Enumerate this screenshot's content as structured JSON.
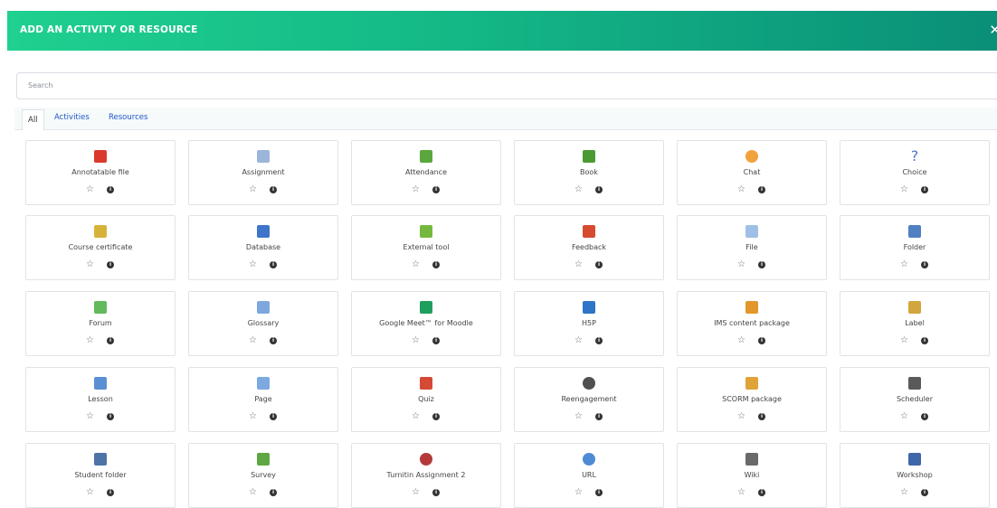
{
  "modal": {
    "title": "ADD AN ACTIVITY OR RESOURCE",
    "close_icon": "close-icon"
  },
  "search": {
    "value": "",
    "placeholder": "Search"
  },
  "tabs": [
    {
      "label": "All",
      "active": true
    },
    {
      "label": "Activities",
      "active": false
    },
    {
      "label": "Resources",
      "active": false
    }
  ],
  "items": [
    {
      "label": "Annotatable file",
      "icon": "annotatable-file-icon",
      "color": "#d93a2b"
    },
    {
      "label": "Assignment",
      "icon": "assignment-icon",
      "color": "#9bb6d9"
    },
    {
      "label": "Attendance",
      "icon": "attendance-icon",
      "color": "#5aa83d"
    },
    {
      "label": "Book",
      "icon": "book-icon",
      "color": "#4a9a34"
    },
    {
      "label": "Chat",
      "icon": "chat-icon",
      "color": "#f2a23c"
    },
    {
      "label": "Choice",
      "icon": "choice-icon",
      "color": "#4d79c7"
    },
    {
      "label": "Course certificate",
      "icon": "certificate-icon",
      "color": "#d7b23b"
    },
    {
      "label": "Database",
      "icon": "database-icon",
      "color": "#3f75c9"
    },
    {
      "label": "External tool",
      "icon": "external-tool-icon",
      "color": "#76b83f"
    },
    {
      "label": "Feedback",
      "icon": "feedback-icon",
      "color": "#d64b2f"
    },
    {
      "label": "File",
      "icon": "file-icon",
      "color": "#9fc0e6"
    },
    {
      "label": "Folder",
      "icon": "folder-icon",
      "color": "#4f80c4"
    },
    {
      "label": "Forum",
      "icon": "forum-icon",
      "color": "#63b95b"
    },
    {
      "label": "Glossary",
      "icon": "glossary-icon",
      "color": "#7ea7dd"
    },
    {
      "label": "Google Meet™ for Moodle",
      "icon": "google-meet-icon",
      "color": "#1f9e5d"
    },
    {
      "label": "H5P",
      "icon": "h5p-icon",
      "color": "#2d75c6"
    },
    {
      "label": "IMS content package",
      "icon": "ims-package-icon",
      "color": "#e1972a"
    },
    {
      "label": "Label",
      "icon": "label-icon",
      "color": "#d2a63c"
    },
    {
      "label": "Lesson",
      "icon": "lesson-icon",
      "color": "#5a8fd3"
    },
    {
      "label": "Page",
      "icon": "page-icon",
      "color": "#7ba9e0"
    },
    {
      "label": "Quiz",
      "icon": "quiz-icon",
      "color": "#d54a35"
    },
    {
      "label": "Reengagement",
      "icon": "reengagement-icon",
      "color": "#505050"
    },
    {
      "label": "SCORM package",
      "icon": "scorm-icon",
      "color": "#e0a33a"
    },
    {
      "label": "Scheduler",
      "icon": "scheduler-icon",
      "color": "#5a5a5a"
    },
    {
      "label": "Student folder",
      "icon": "student-folder-icon",
      "color": "#4e74a7"
    },
    {
      "label": "Survey",
      "icon": "survey-icon",
      "color": "#5ea743"
    },
    {
      "label": "Turnitin Assignment 2",
      "icon": "turnitin-icon",
      "color": "#b43a3a"
    },
    {
      "label": "URL",
      "icon": "url-icon",
      "color": "#4e8bd4"
    },
    {
      "label": "Wiki",
      "icon": "wiki-icon",
      "color": "#6a6a6a"
    },
    {
      "label": "Workshop",
      "icon": "workshop-icon",
      "color": "#3f66a8"
    }
  ]
}
